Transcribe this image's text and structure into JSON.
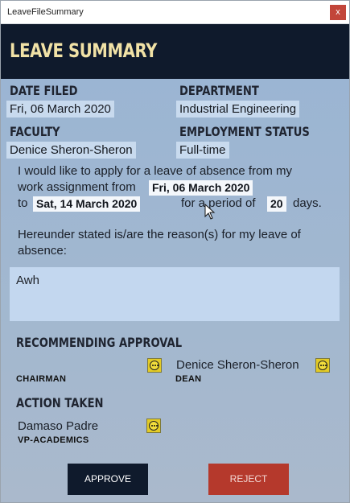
{
  "window": {
    "title": "LeaveFileSummary",
    "close_glyph": "x"
  },
  "header": {
    "title": "LEAVE SUMMARY"
  },
  "fields": {
    "date_filed": {
      "label": "DATE FILED",
      "value": "Fri, 06 March 2020"
    },
    "department": {
      "label": "DEPARTMENT",
      "value": "Industrial Engineering"
    },
    "faculty": {
      "label": "FACULTY",
      "value": "Denice Sheron-Sheron"
    },
    "employment_status": {
      "label": "EMPLOYMENT STATUS",
      "value": "Full-time"
    }
  },
  "request": {
    "line1": "I would like to apply for a leave of absence from my",
    "line2_prefix": "work assignment from",
    "from_date": "Fri, 06 March 2020",
    "to_word": "to",
    "to_date": "Sat, 14 March 2020",
    "period_text": "for a period of",
    "days_count": "20",
    "days_word": "days."
  },
  "reason": {
    "intro_line1": "Hereunder stated is/are the reason(s) for my leave of",
    "intro_line2": "absence:",
    "text": "Awh"
  },
  "recommending": {
    "heading": "RECOMMENDING APPROVAL",
    "chairman_role": "CHAIRMAN",
    "dean_name": "Denice Sheron-Sheron",
    "dean_role": "DEAN"
  },
  "action": {
    "heading": "ACTION TAKEN",
    "vp_name": "Damaso Padre",
    "vp_role": "VP-ACADEMICS"
  },
  "buttons": {
    "approve": "APPROVE",
    "reject": "REJECT"
  },
  "icons": {
    "status": "pending-status-icon",
    "cursor": "mouse-cursor-icon"
  },
  "colors": {
    "header_bg": "#0f1a2c",
    "header_text": "#f1e2a6",
    "reject_bg": "#b5392c",
    "status_icon": "#e3cb26"
  }
}
